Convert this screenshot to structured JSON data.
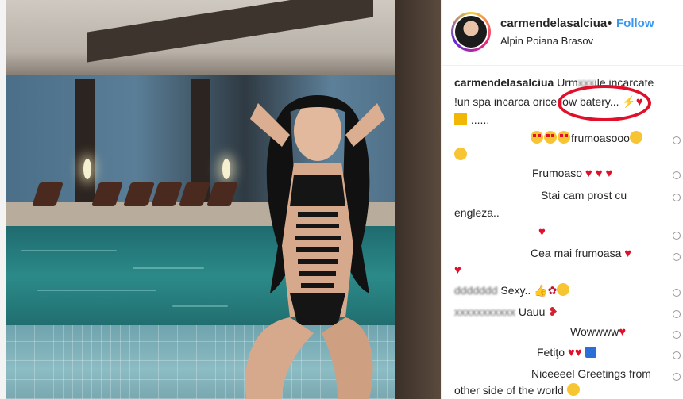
{
  "post": {
    "username": "carmendelasalciua",
    "dot": "•",
    "follow_label": "Follow",
    "location": "Alpin Poiana Brasov"
  },
  "caption": {
    "author": "carmendelasalciua",
    "line1": "Urm",
    "line1_tail": "ile incarcate",
    "line2": "!un spa incarca orice low batery...",
    "line3": "......"
  },
  "comments": [
    {
      "text": "frumoasooo"
    },
    {
      "text": "Frumoaso"
    },
    {
      "text": "Stai cam prost cu"
    },
    {
      "text": "engleza.."
    },
    {
      "text": "Cea mai frumoasa"
    },
    {
      "text": "Sexy.."
    },
    {
      "text": "Uauu"
    },
    {
      "text": "Wowwww"
    },
    {
      "text": "Fetiţo"
    },
    {
      "text": "Niceeeel Greetings from"
    },
    {
      "text": "other side of the world"
    }
  ],
  "colors": {
    "follow": "#3897f0",
    "heart": "#e0102a",
    "annotation": "#e0102a"
  },
  "icons": [
    "heart-icon",
    "star-eyes-emoji",
    "kiss-emoji",
    "thumbs-up-emoji",
    "rose-emoji",
    "lips-emoji",
    "smile-emoji",
    "top-emoji",
    "like-icon"
  ]
}
